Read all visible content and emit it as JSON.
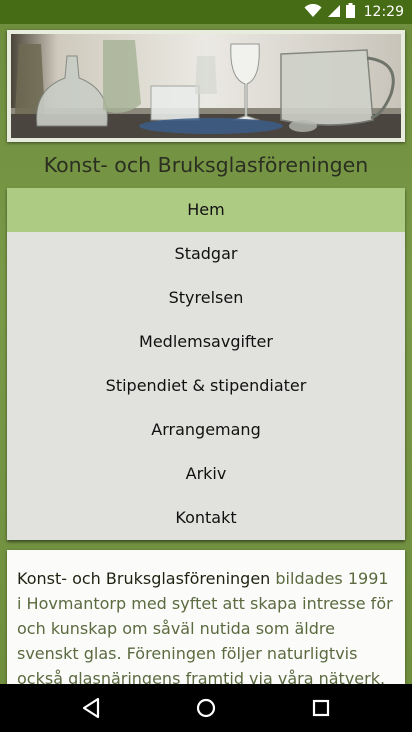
{
  "status_bar": {
    "time": "12:29",
    "icons": [
      "wifi-icon",
      "signal-icon",
      "battery-icon"
    ]
  },
  "banner": {
    "description_icon": "glassware-photo"
  },
  "site": {
    "title": "Konst- och Bruksglasföreningen"
  },
  "menu": {
    "items": [
      {
        "label": "Hem",
        "active": true
      },
      {
        "label": "Stadgar"
      },
      {
        "label": "Styrelsen"
      },
      {
        "label": "Medlemsavgifter"
      },
      {
        "label": "Stipendiet & stipendiater"
      },
      {
        "label": "Arrangemang"
      },
      {
        "label": "Arkiv"
      },
      {
        "label": "Kontakt"
      }
    ]
  },
  "intro": {
    "strong": "Konst- och Bruksglasföreningen",
    "text": " bildades 1991 i Hovmantorp med syftet att skapa intresse för och kunskap om såväl nutida som äldre svenskt glas. Föreningen följer naturligtvis också glasnäringens framtid via våra nätverk."
  },
  "system_nav": {
    "icons": [
      "back-icon",
      "home-icon",
      "recents-icon"
    ]
  },
  "colors": {
    "status_bar": "#466c15",
    "page_bg": "#6b8a3a",
    "active_item": "#aecb84",
    "menu_bg": "#e1e1de"
  }
}
